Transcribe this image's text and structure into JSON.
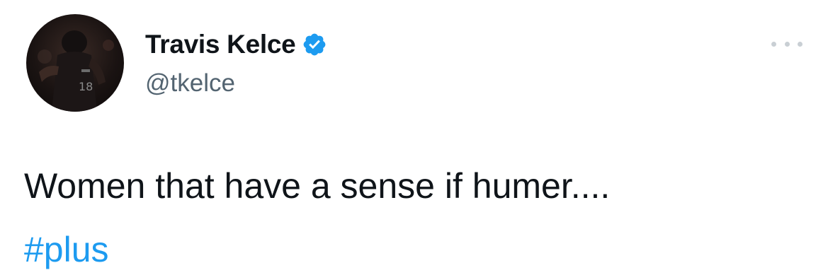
{
  "author": {
    "display_name": "Travis Kelce",
    "handle": "@tkelce",
    "verified": true,
    "avatar_icon": "profile-photo-football-player"
  },
  "menu": {
    "icon": "more-options-icon"
  },
  "tweet": {
    "text": "Women that have a sense if humer....",
    "hashtag": "#plus"
  },
  "colors": {
    "text": "#0f1419",
    "secondary": "#536471",
    "link": "#1d9bf0",
    "verified_badge": "#1d9bf0",
    "more_dots": "#c9cfd4"
  }
}
